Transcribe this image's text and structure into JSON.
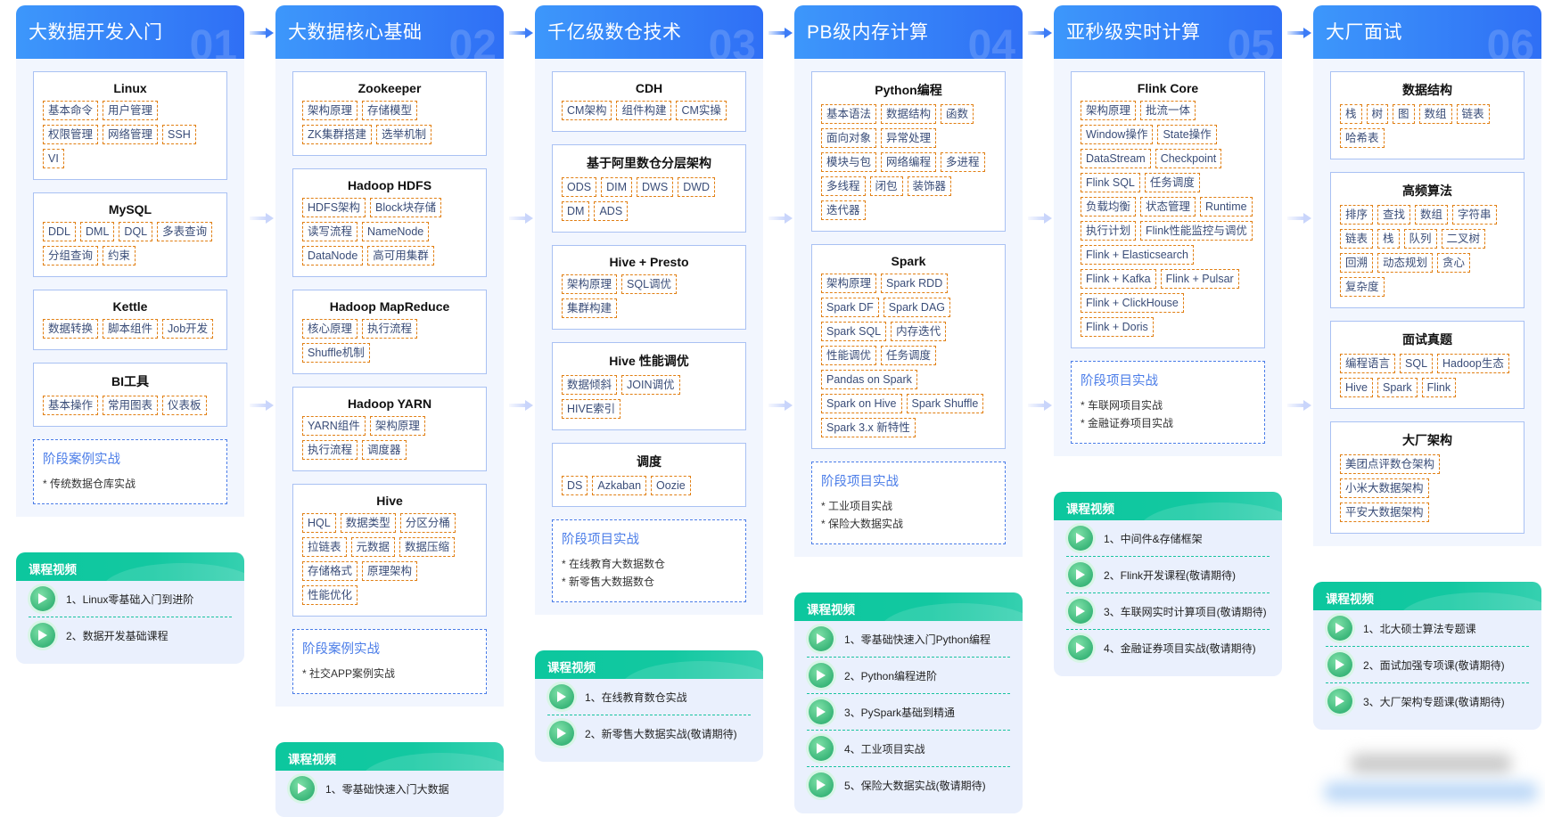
{
  "stages": [
    {
      "title": "大数据开发入门",
      "number": "01",
      "topics": [
        {
          "title": "Linux",
          "tags": [
            "基本命令",
            "用户管理",
            "权限管理",
            "网络管理",
            "SSH",
            "VI"
          ]
        },
        {
          "title": "MySQL",
          "tags": [
            "DDL",
            "DML",
            "DQL",
            "多表查询",
            "分组查询",
            "约束"
          ]
        },
        {
          "title": "Kettle",
          "tags": [
            "数据转换",
            "脚本组件",
            "Job开发"
          ]
        },
        {
          "title": "BI工具",
          "tags": [
            "基本操作",
            "常用图表",
            "仪表板"
          ]
        }
      ],
      "practice": {
        "title": "阶段案例实战",
        "items": [
          "* 传统数据仓库实战"
        ]
      },
      "videos": {
        "title": "课程视频",
        "items": [
          "1、Linux零基础入门到进阶",
          "2、数据开发基础课程"
        ]
      }
    },
    {
      "title": "大数据核心基础",
      "number": "02",
      "topics": [
        {
          "title": "Zookeeper",
          "tags": [
            "架构原理",
            "存储模型",
            "ZK集群搭建",
            "选举机制"
          ]
        },
        {
          "title": "Hadoop HDFS",
          "tags": [
            "HDFS架构",
            "Block块存储",
            "读写流程",
            "NameNode",
            "DataNode",
            "高可用集群"
          ]
        },
        {
          "title": "Hadoop MapReduce",
          "tags": [
            "核心原理",
            "执行流程",
            "Shuffle机制"
          ]
        },
        {
          "title": "Hadoop YARN",
          "tags": [
            "YARN组件",
            "架构原理",
            "执行流程",
            "调度器"
          ]
        },
        {
          "title": "Hive",
          "tags": [
            "HQL",
            "数据类型",
            "分区分桶",
            "拉链表",
            "元数据",
            "数据压缩",
            "存储格式",
            "原理架构",
            "性能优化"
          ]
        }
      ],
      "practice": {
        "title": "阶段案例实战",
        "items": [
          "* 社交APP案例实战"
        ]
      },
      "videos": {
        "title": "课程视频",
        "items": [
          "1、零基础快速入门大数据"
        ]
      }
    },
    {
      "title": "千亿级数仓技术",
      "number": "03",
      "topics": [
        {
          "title": "CDH",
          "tags": [
            "CM架构",
            "组件构建",
            "CM实操"
          ]
        },
        {
          "title": "基于阿里数仓分层架构",
          "tags": [
            "ODS",
            "DIM",
            "DWS",
            "DWD",
            "DM",
            "ADS"
          ]
        },
        {
          "title": "Hive + Presto",
          "tags": [
            "架构原理",
            "SQL调优",
            "集群构建"
          ]
        },
        {
          "title": "Hive 性能调优",
          "tags": [
            "数据倾斜",
            "JOIN调优",
            "HIVE索引"
          ]
        },
        {
          "title": "调度",
          "tags": [
            "DS",
            "Azkaban",
            "Oozie"
          ]
        }
      ],
      "practice": {
        "title": "阶段项目实战",
        "items": [
          "* 在线教育大数据数仓",
          "* 新零售大数据数仓"
        ]
      },
      "videos": {
        "title": "课程视频",
        "items": [
          "1、在线教育数仓实战",
          "2、新零售大数据实战(敬请期待)"
        ]
      }
    },
    {
      "title": "PB级内存计算",
      "number": "04",
      "topics": [
        {
          "title": "Python编程",
          "tags": [
            "基本语法",
            "数据结构",
            "函数",
            "面向对象",
            "异常处理",
            "模块与包",
            "网络编程",
            "多进程",
            "多线程",
            "闭包",
            "装饰器",
            "迭代器"
          ]
        },
        {
          "title": "Spark",
          "tags": [
            "架构原理",
            "Spark RDD",
            "Spark DF",
            "Spark DAG",
            "Spark SQL",
            "内存迭代",
            "性能调优",
            "任务调度",
            "Pandas on Spark",
            "Spark on Hive",
            "Spark Shuffle",
            "Spark 3.x 新特性"
          ]
        }
      ],
      "practice": {
        "title": "阶段项目实战",
        "items": [
          "* 工业项目实战",
          "* 保险大数据实战"
        ]
      },
      "videos": {
        "title": "课程视频",
        "items": [
          "1、零基础快速入门Python编程",
          "2、Python编程进阶",
          "3、PySpark基础到精通",
          "4、工业项目实战",
          "5、保险大数据实战(敬请期待)"
        ]
      }
    },
    {
      "title": "亚秒级实时计算",
      "number": "05",
      "topics": [
        {
          "title": "Flink Core",
          "tags": [
            "架构原理",
            "批流一体",
            "Window操作",
            "State操作",
            "DataStream",
            "Checkpoint",
            "Flink SQL",
            "任务调度",
            "负载均衡",
            "状态管理",
            "Runtime",
            "执行计划",
            "Flink性能监控与调优",
            "Flink + Elasticsearch",
            "Flink + Kafka",
            "Flink + Pulsar",
            "Flink + ClickHouse",
            "Flink + Doris"
          ]
        }
      ],
      "practice": {
        "title": "阶段项目实战",
        "items": [
          "* 车联网项目实战",
          "* 金融证券项目实战"
        ]
      },
      "videos": {
        "title": "课程视频",
        "items": [
          "1、中间件&存储框架",
          "2、Flink开发课程(敬请期待)",
          "3、车联网实时计算项目(敬请期待)",
          "4、金融证券项目实战(敬请期待)"
        ]
      }
    },
    {
      "title": "大厂面试",
      "number": "06",
      "topics": [
        {
          "title": "数据结构",
          "tags": [
            "栈",
            "树",
            "图",
            "数组",
            "链表",
            "哈希表"
          ]
        },
        {
          "title": "高频算法",
          "tags": [
            "排序",
            "查找",
            "数组",
            "字符串",
            "链表",
            "栈",
            "队列",
            "二叉树",
            "回溯",
            "动态规划",
            "贪心",
            "复杂度"
          ]
        },
        {
          "title": "面试真题",
          "tags": [
            "编程语言",
            "SQL",
            "Hadoop生态",
            "Hive",
            "Spark",
            "Flink"
          ]
        },
        {
          "title": "大厂架构",
          "tags": [
            "美团点评数仓架构",
            "小米大数据架构",
            "平安大数据架构"
          ]
        }
      ],
      "practice": null,
      "videos": {
        "title": "课程视频",
        "items": [
          "1、北大硕士算法专题课",
          "2、面试加强专项课(敬请期待)",
          "3、大厂架构专题课(敬请期待)"
        ]
      }
    }
  ],
  "colors": {
    "header_blue": "#2f6ff5",
    "video_green": "#0cc79e",
    "tag_border": "#e17f13",
    "practice_blue": "#4b7de8"
  },
  "icons": {
    "play": "play-icon",
    "arrow": "arrow-right-icon"
  }
}
